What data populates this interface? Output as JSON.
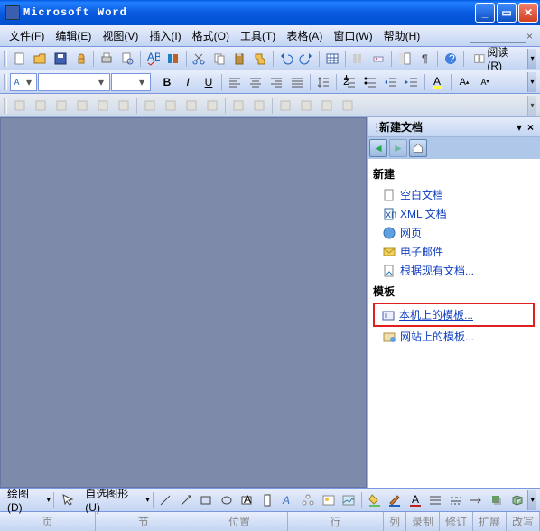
{
  "window": {
    "title": "Microsoft Word"
  },
  "menu": {
    "file": "文件(F)",
    "edit": "编辑(E)",
    "view": "视图(V)",
    "insert": "插入(I)",
    "format": "格式(O)",
    "tools": "工具(T)",
    "table": "表格(A)",
    "window": "窗口(W)",
    "help": "帮助(H)"
  },
  "toolbar": {
    "read_label": "阅读(R)"
  },
  "taskpane": {
    "title": "新建文档",
    "section_new": "新建",
    "links_new": {
      "blank": "空白文档",
      "xml": "XML 文档",
      "web": "网页",
      "email": "电子邮件",
      "existing": "根据现有文档..."
    },
    "section_tpl": "模板",
    "links_tpl": {
      "local": "本机上的模板...",
      "web": "网站上的模板..."
    }
  },
  "drawbar": {
    "draw": "绘图(D)",
    "autoshape": "自选图形(U)"
  },
  "status": {
    "page": "页",
    "sec": "节",
    "pos": "位置",
    "line": "行",
    "col": "列",
    "rec": "录制",
    "rev": "修订",
    "ext": "扩展",
    "ovr": "改写"
  }
}
